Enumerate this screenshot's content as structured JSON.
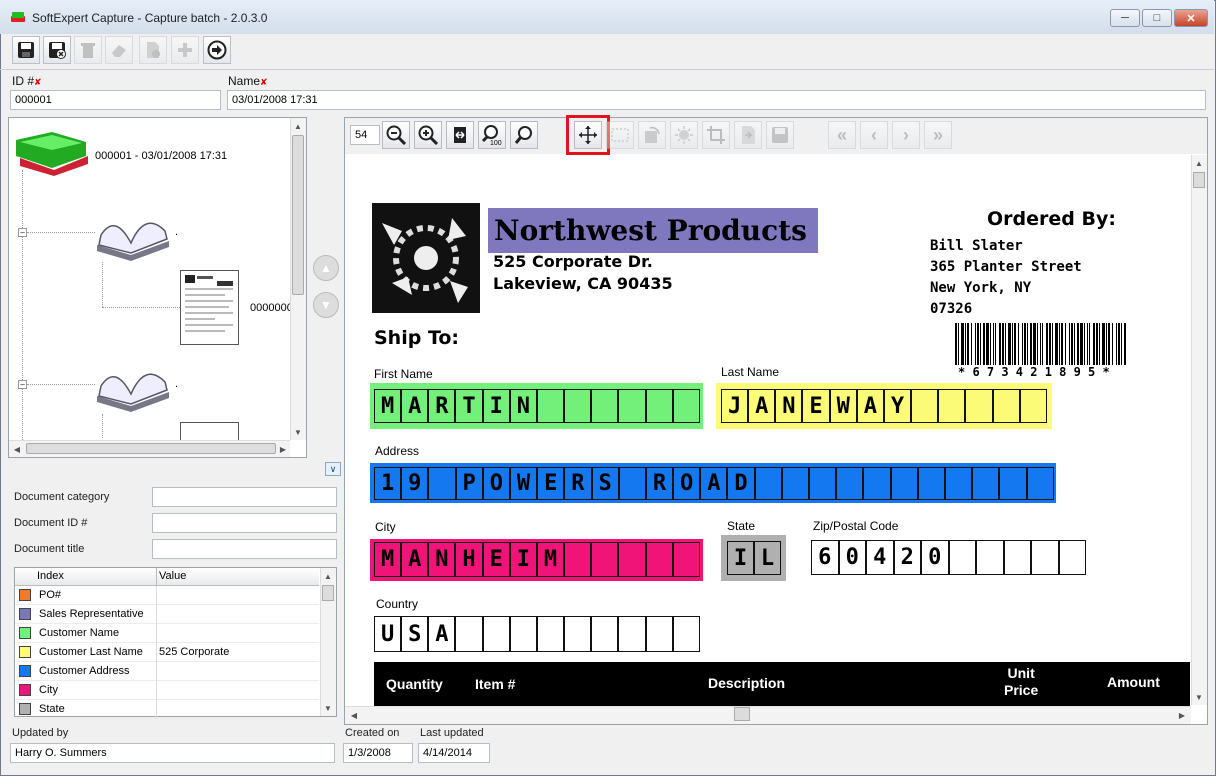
{
  "window": {
    "title": "SoftExpert Capture - Capture batch - 2.0.3.0"
  },
  "toolbar": {
    "buttons": [
      "save",
      "save-close",
      "delete",
      "erase",
      "new-document",
      "add",
      "send"
    ]
  },
  "batch": {
    "id_label": "ID #",
    "id_value": "000001",
    "name_label": "Name",
    "name_value": "03/01/2008 17:31"
  },
  "tree": {
    "root_label": "000001 - 03/01/2008 17:31",
    "doc1_label": ".",
    "page1_label": "0000000",
    "doc2_label": "."
  },
  "document": {
    "category_label": "Document category",
    "id_label": "Document ID #",
    "title_label": "Document title",
    "category_value": "",
    "id_value": "",
    "title_value": ""
  },
  "index_table": {
    "headers": [
      "Index",
      "Value"
    ],
    "rows": [
      {
        "name": "PO#",
        "value": "",
        "color": "#f07a2a"
      },
      {
        "name": "Sales Representative",
        "value": "",
        "color": "#7a78b8"
      },
      {
        "name": "Customer Name",
        "value": "",
        "color": "#72f07a"
      },
      {
        "name": "Customer Last Name",
        "value": "525 Corporate",
        "color": "#fbfb78"
      },
      {
        "name": "Customer Address",
        "value": "",
        "color": "#1478f0"
      },
      {
        "name": "City",
        "value": "",
        "color": "#f01478"
      },
      {
        "name": "State",
        "value": "",
        "color": "#b0b0b0"
      }
    ]
  },
  "viewer": {
    "zoom": "54"
  },
  "form": {
    "company": "Northwest Products",
    "addr1": "525 Corporate Dr.",
    "addr2": "Lakeview, CA  90435",
    "ordered_by": "Ordered By:",
    "ob_name": "Bill Slater",
    "ob_street": "365 Planter Street",
    "ob_city": "New York, NY",
    "ob_zip": "07326",
    "barcode_text": "* 6 7 3 4 2 1 8 9 5 *",
    "ship_to": "Ship To:",
    "first_name_label": "First Name",
    "last_name_label": "Last Name",
    "address_label": "Address",
    "city_label": "City",
    "state_label": "State",
    "zip_label": "Zip/Postal Code",
    "country_label": "Country",
    "first_name": "MARTIN",
    "last_name": "JANEWAY",
    "address": "19 POWERS ROAD",
    "city": "MANHEIM",
    "state": "IL",
    "zip": "60420",
    "country": "USA",
    "table_headers": [
      "Quantity",
      "Item #",
      "Description",
      "Unit\nPrice",
      "Amount"
    ]
  },
  "footer": {
    "updated_by_label": "Updated by",
    "updated_by_value": "Harry O. Summers",
    "created_label": "Created on",
    "created_value": "1/3/2008",
    "last_updated_label": "Last updated",
    "last_updated_value": "4/14/2014"
  }
}
